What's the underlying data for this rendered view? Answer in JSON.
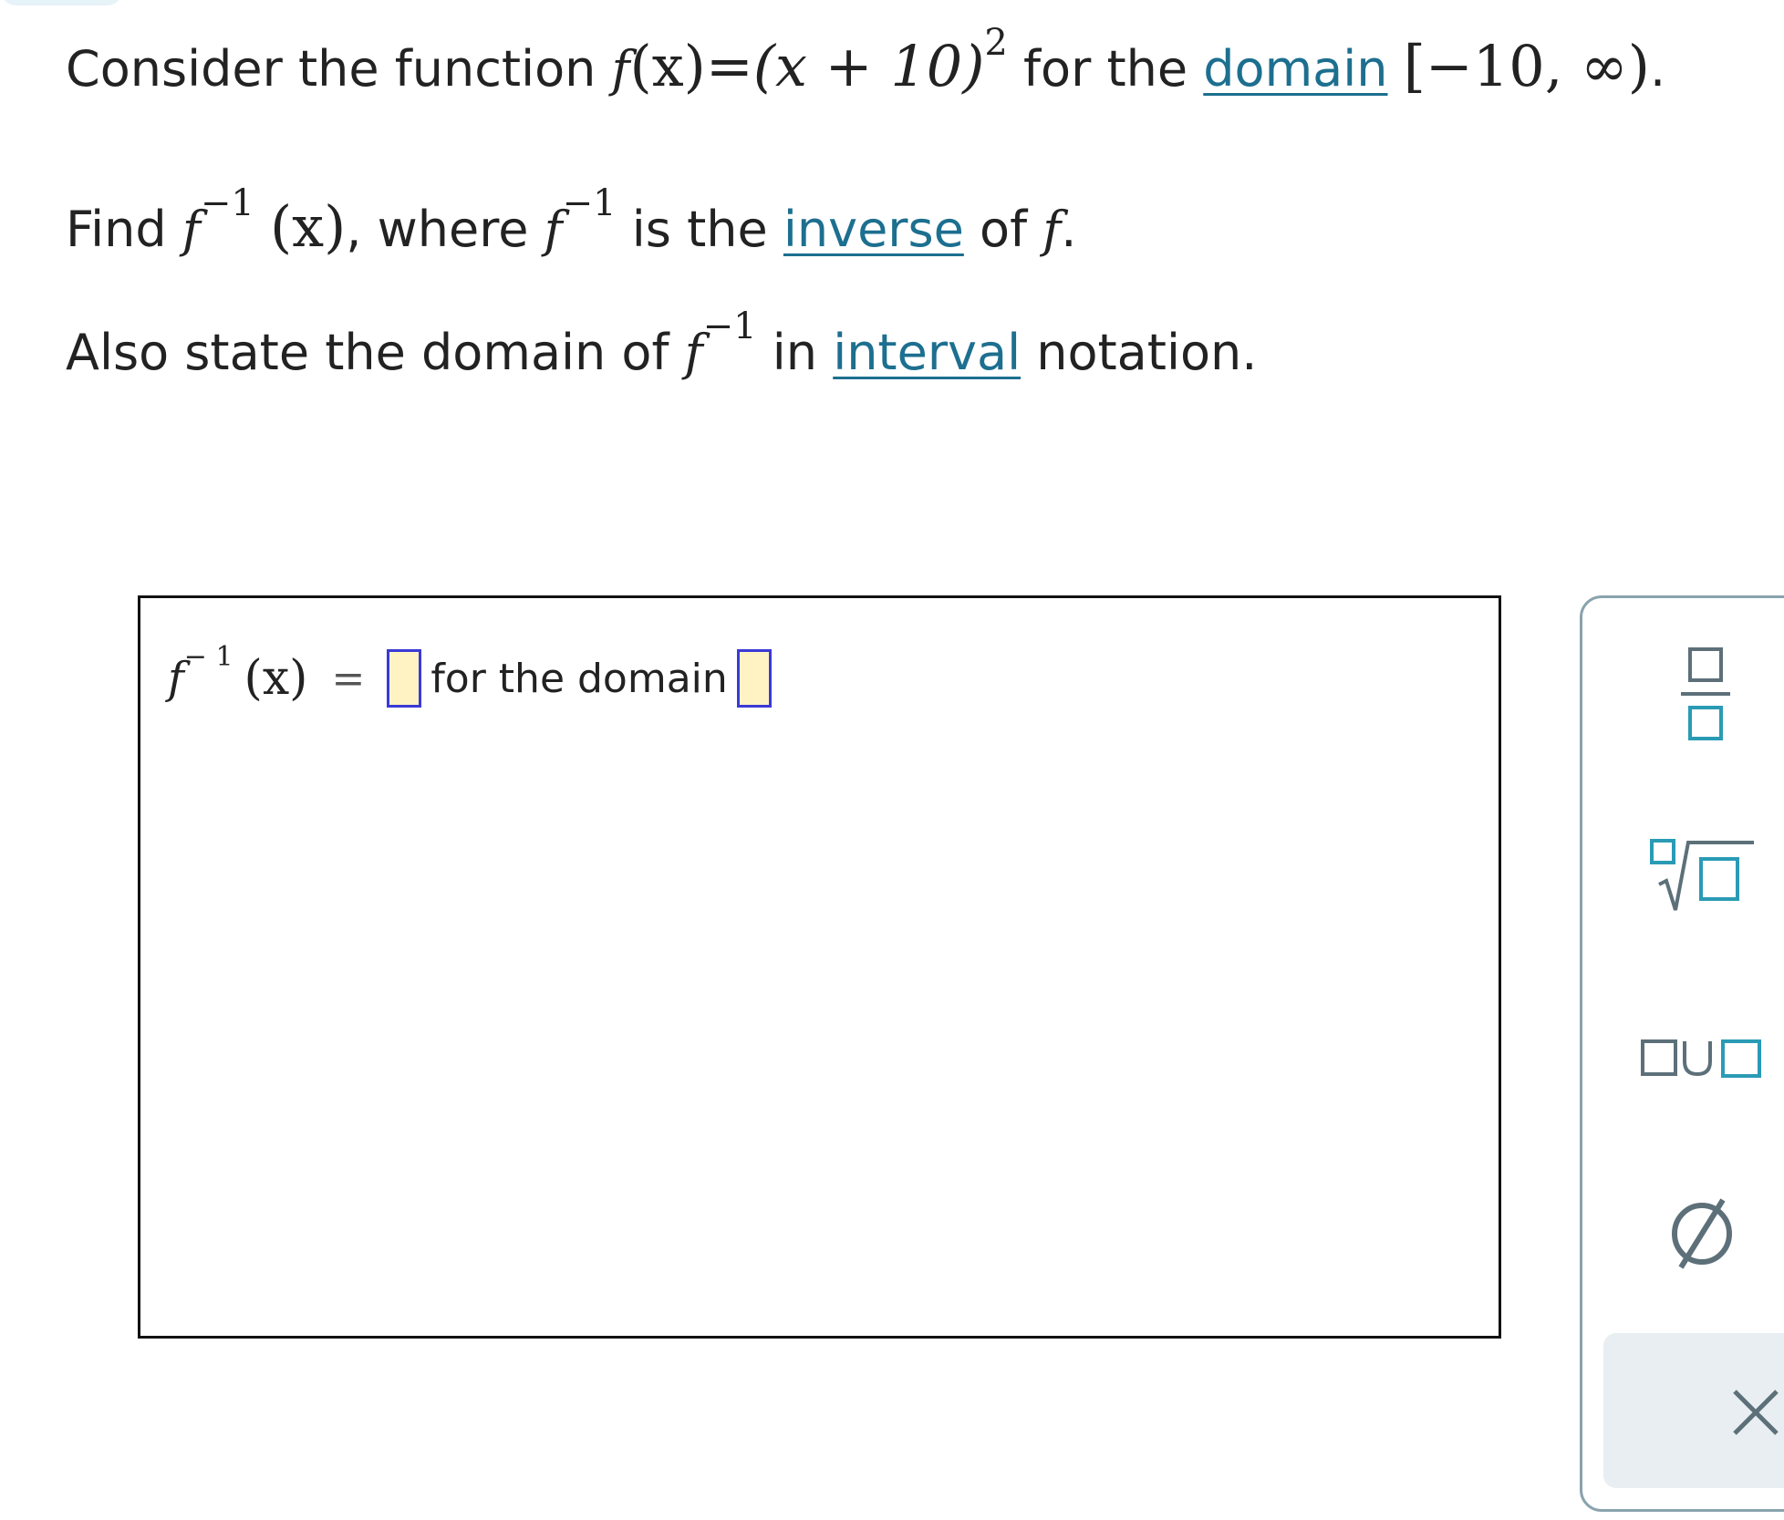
{
  "problem": {
    "line1": {
      "prefix": "Consider the function",
      "function_name": "f",
      "arg": "(x)",
      "equals": "=",
      "expr": "(x + 10)",
      "exponent": "2",
      "mid": "for the",
      "link": "domain",
      "interval": "[−10, ∞)",
      "end": "."
    },
    "line2": {
      "prefix": "Find",
      "f": "f",
      "exponent": "−1",
      "arg": "(x)",
      "mid1": ", where",
      "f2": "f",
      "exponent2": "−1",
      "mid2": "is the",
      "link": "inverse",
      "mid3": "of",
      "f3": "f",
      "end": "."
    },
    "line3": {
      "prefix": "Also state the domain of",
      "f": "f",
      "exponent": "−1",
      "mid": "in",
      "link": "interval",
      "end": "notation."
    }
  },
  "answer": {
    "f": "f",
    "exponent": "− 1",
    "arg": "(x)",
    "equals": "=",
    "domain_label": "for the domain"
  },
  "toolbar": {
    "icons": [
      "fraction-icon",
      "nth-root-icon",
      "union-icon",
      "empty-set-icon",
      "close-icon"
    ],
    "empty_set_symbol": "∅",
    "union_symbol": "∪",
    "clear_symbol": "×"
  },
  "colors": {
    "link": "#1d6f8f",
    "blank_fill": "#fff3c4",
    "blank_border": "#3a3ad6",
    "teal_icon": "#2a9bb5",
    "gray_icon": "#5d7079"
  }
}
